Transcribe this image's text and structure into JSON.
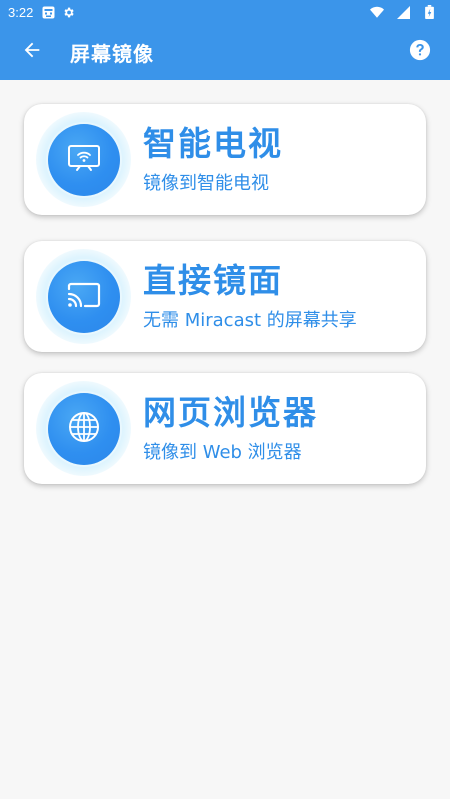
{
  "status_bar": {
    "time": "3:22",
    "icons": [
      "app-notification-icon",
      "settings-gear-icon",
      "wifi-icon",
      "cellular-signal-icon",
      "battery-icon"
    ]
  },
  "app_bar": {
    "back_icon": "arrow-left-icon",
    "title": "屏幕镜像",
    "help_icon": "help-circle-icon"
  },
  "cards": [
    {
      "icon": "smart-tv-icon",
      "title": "智能电视",
      "subtitle": "镜像到智能电视"
    },
    {
      "icon": "cast-icon",
      "title": "直接镜面",
      "subtitle": "无需 Miracast 的屏幕共享"
    },
    {
      "icon": "globe-icon",
      "title": "网页浏览器",
      "subtitle": "镜像到 Web 浏览器"
    }
  ],
  "colors": {
    "primary": "#3b95ea",
    "accent_text": "#2f8ee8",
    "background": "#f7f7f7",
    "card": "#ffffff"
  }
}
